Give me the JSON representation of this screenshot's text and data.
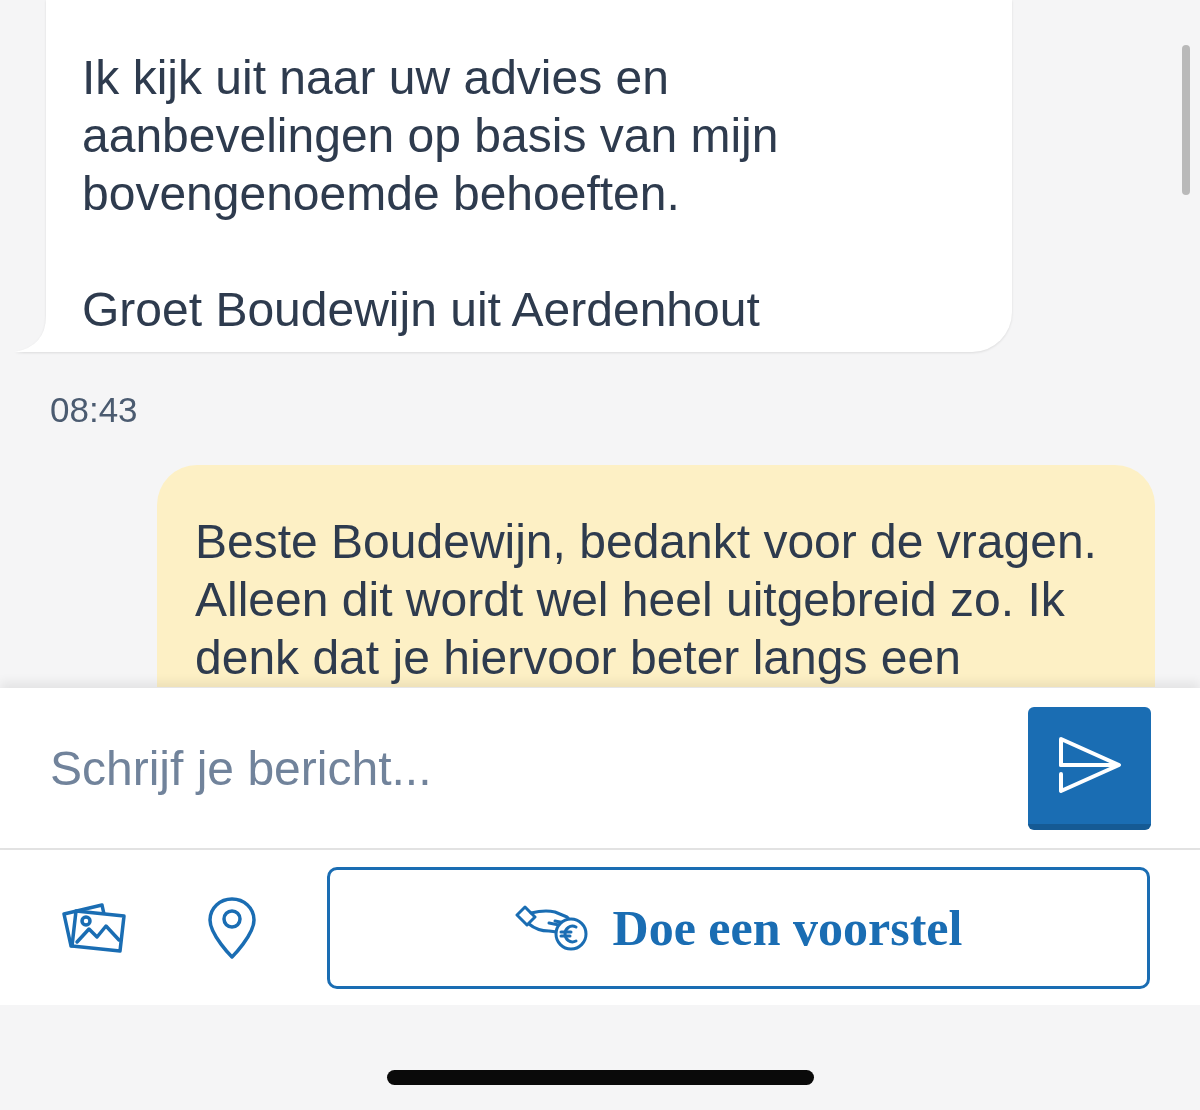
{
  "messages": [
    {
      "kind": "received",
      "paragraphs": [
        "Ik kijk uit naar uw advies en aanbevelingen op basis van mijn bovengenoemde behoeften.",
        "Groet Boudewijn uit Aerdenhout"
      ]
    },
    {
      "kind": "timestamp",
      "text": "08:43"
    },
    {
      "kind": "sent",
      "paragraphs": [
        "Beste Boudewijn, bedankt voor de vragen. Alleen dit wordt wel heel uitgebreid zo. Ik denk dat je hiervoor beter langs een"
      ]
    }
  ],
  "composer": {
    "placeholder": "Schrijf je bericht..."
  },
  "toolbar": {
    "offer_button": "Doe een voorstel"
  }
}
